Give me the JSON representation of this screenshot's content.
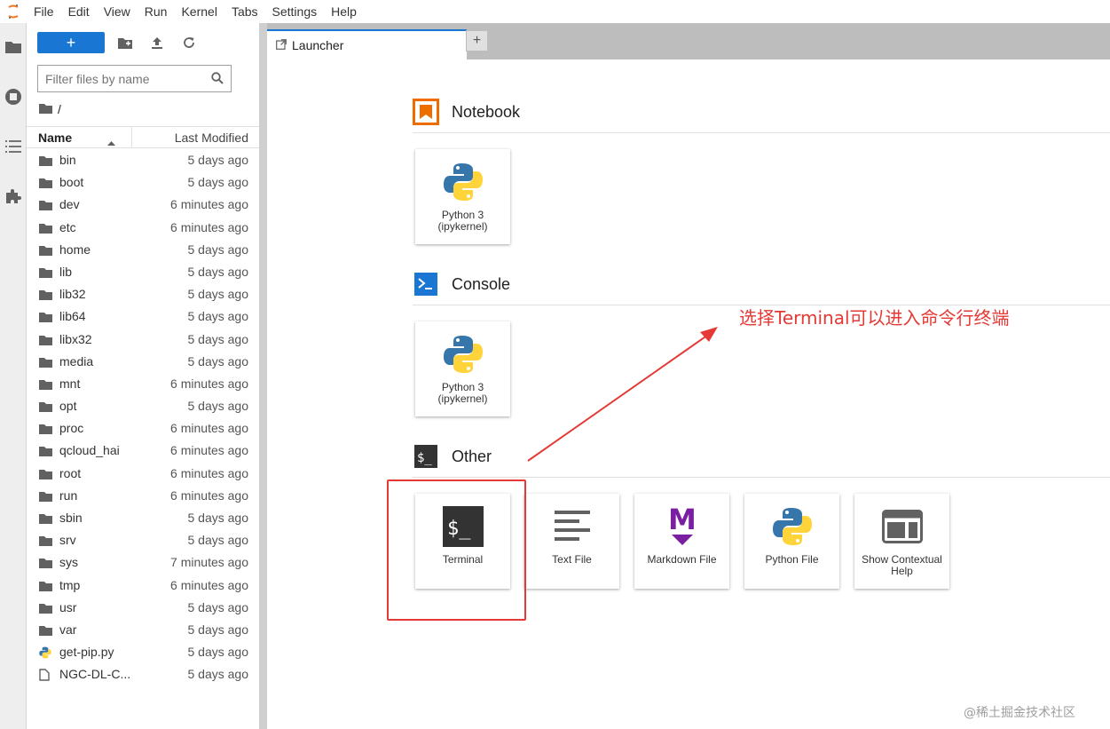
{
  "menu": [
    "File",
    "Edit",
    "View",
    "Run",
    "Kernel",
    "Tabs",
    "Settings",
    "Help"
  ],
  "filebrowser": {
    "new_label": "+",
    "filter_placeholder": "Filter files by name",
    "breadcrumb": "/",
    "col_name": "Name",
    "col_modified": "Last Modified",
    "files": [
      {
        "name": "bin",
        "modified": "5 days ago",
        "type": "folder"
      },
      {
        "name": "boot",
        "modified": "5 days ago",
        "type": "folder"
      },
      {
        "name": "dev",
        "modified": "6 minutes ago",
        "type": "folder"
      },
      {
        "name": "etc",
        "modified": "6 minutes ago",
        "type": "folder"
      },
      {
        "name": "home",
        "modified": "5 days ago",
        "type": "folder"
      },
      {
        "name": "lib",
        "modified": "5 days ago",
        "type": "folder"
      },
      {
        "name": "lib32",
        "modified": "5 days ago",
        "type": "folder"
      },
      {
        "name": "lib64",
        "modified": "5 days ago",
        "type": "folder"
      },
      {
        "name": "libx32",
        "modified": "5 days ago",
        "type": "folder"
      },
      {
        "name": "media",
        "modified": "5 days ago",
        "type": "folder"
      },
      {
        "name": "mnt",
        "modified": "6 minutes ago",
        "type": "folder"
      },
      {
        "name": "opt",
        "modified": "5 days ago",
        "type": "folder"
      },
      {
        "name": "proc",
        "modified": "6 minutes ago",
        "type": "folder"
      },
      {
        "name": "qcloud_hai",
        "modified": "6 minutes ago",
        "type": "folder"
      },
      {
        "name": "root",
        "modified": "6 minutes ago",
        "type": "folder"
      },
      {
        "name": "run",
        "modified": "6 minutes ago",
        "type": "folder"
      },
      {
        "name": "sbin",
        "modified": "5 days ago",
        "type": "folder"
      },
      {
        "name": "srv",
        "modified": "5 days ago",
        "type": "folder"
      },
      {
        "name": "sys",
        "modified": "7 minutes ago",
        "type": "folder"
      },
      {
        "name": "tmp",
        "modified": "6 minutes ago",
        "type": "folder"
      },
      {
        "name": "usr",
        "modified": "5 days ago",
        "type": "folder"
      },
      {
        "name": "var",
        "modified": "5 days ago",
        "type": "folder"
      },
      {
        "name": "get-pip.py",
        "modified": "5 days ago",
        "type": "python"
      },
      {
        "name": "NGC-DL-C...",
        "modified": "5 days ago",
        "type": "file"
      }
    ]
  },
  "tabs": [
    {
      "label": "Launcher"
    }
  ],
  "tab_add": "+",
  "launcher": {
    "notebook_title": "Notebook",
    "console_title": "Console",
    "other_title": "Other",
    "notebook_card": {
      "label": "Python 3",
      "sub": "(ipykernel)"
    },
    "console_card": {
      "label": "Python 3",
      "sub": "(ipykernel)"
    },
    "other_cards": [
      {
        "label": "Terminal",
        "icon": "terminal-icon"
      },
      {
        "label": "Text File",
        "icon": "text-file-icon"
      },
      {
        "label": "Markdown File",
        "icon": "markdown-icon"
      },
      {
        "label": "Python File",
        "icon": "python-icon"
      },
      {
        "label": "Show Contextual Help",
        "icon": "contextual-help-icon"
      }
    ]
  },
  "annotation": "选择Terminal可以进入命令行终端",
  "watermark": "@稀土掘金技术社区",
  "colors": {
    "accent": "#1976d2",
    "annotation": "#e53935",
    "notebook": "#ef6c00"
  }
}
